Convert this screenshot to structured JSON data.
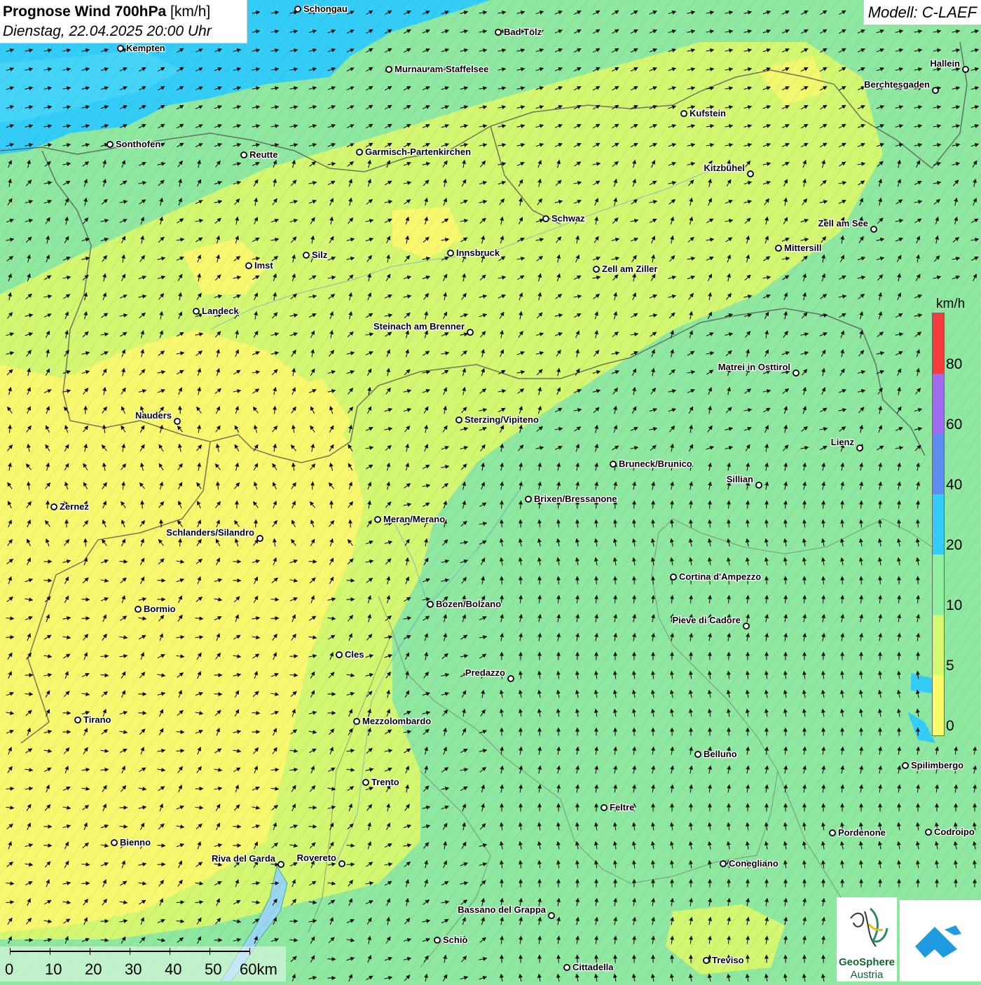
{
  "header": {
    "title_bold": "Prognose Wind 700hPa",
    "title_unit": "[km/h]",
    "datetime": "Dienstag, 22.04.2025 20:00 Uhr"
  },
  "model_label": "Modell: C-LAEF",
  "legend": {
    "unit": "km/h",
    "colors": [
      "#fbfb6a",
      "#d5f870",
      "#8ff0a0",
      "#33cdf8",
      "#5b8cf0",
      "#9c6bf0",
      "#f53b3b"
    ],
    "ticks": [
      "0",
      "5",
      "10",
      "20",
      "40",
      "60",
      "80"
    ]
  },
  "scale_bar": {
    "labels": [
      "0",
      "10",
      "20",
      "30",
      "40",
      "50",
      "60km"
    ]
  },
  "logos": {
    "geosphere_line1": "GeoSphere",
    "geosphere_line2": "Austria"
  },
  "cities": [
    {
      "name": "Schongau"
    },
    {
      "name": "Bad Tölz"
    },
    {
      "name": "Kempten"
    },
    {
      "name": "Murnau am Staffelsee"
    },
    {
      "name": "Hallein"
    },
    {
      "name": "Berchtesgaden"
    },
    {
      "name": "Kufstein"
    },
    {
      "name": "Sonthofen"
    },
    {
      "name": "Reutte"
    },
    {
      "name": "Garmisch-Partenkirchen"
    },
    {
      "name": "Kitzbühel"
    },
    {
      "name": "Schwaz"
    },
    {
      "name": "Zell am See"
    },
    {
      "name": "Mittersill"
    },
    {
      "name": "Innsbruck"
    },
    {
      "name": "Silz"
    },
    {
      "name": "Imst"
    },
    {
      "name": "Zell am Ziller"
    },
    {
      "name": "Landeck"
    },
    {
      "name": "Steinach am Brenner"
    },
    {
      "name": "Matrei in Osttirol"
    },
    {
      "name": "Nauders"
    },
    {
      "name": "Sterzing/Vipiteno"
    },
    {
      "name": "Lienz"
    },
    {
      "name": "Bruneck/Brunico"
    },
    {
      "name": "Sillian"
    },
    {
      "name": "Zernez"
    },
    {
      "name": "Brixen/Bressanone"
    },
    {
      "name": "Meran/Merano"
    },
    {
      "name": "Schlanders/Silandro"
    },
    {
      "name": "Cortina d'Ampezzo"
    },
    {
      "name": "Bozen/Bolzano"
    },
    {
      "name": "Bormio"
    },
    {
      "name": "Pieve di Cadore"
    },
    {
      "name": "Cles"
    },
    {
      "name": "Predazzo"
    },
    {
      "name": "Tirano"
    },
    {
      "name": "Mezzolombardo"
    },
    {
      "name": "Belluno"
    },
    {
      "name": "Spilimbergo"
    },
    {
      "name": "Trento"
    },
    {
      "name": "Feltre"
    },
    {
      "name": "Bienno"
    },
    {
      "name": "Pordenone"
    },
    {
      "name": "Codroipo"
    },
    {
      "name": "Riva del Garda"
    },
    {
      "name": "Rovereto"
    },
    {
      "name": "Conegliano"
    },
    {
      "name": "Bassano del Grappa"
    },
    {
      "name": "Schio"
    },
    {
      "name": "Treviso"
    },
    {
      "name": "Cittadella"
    }
  ]
}
